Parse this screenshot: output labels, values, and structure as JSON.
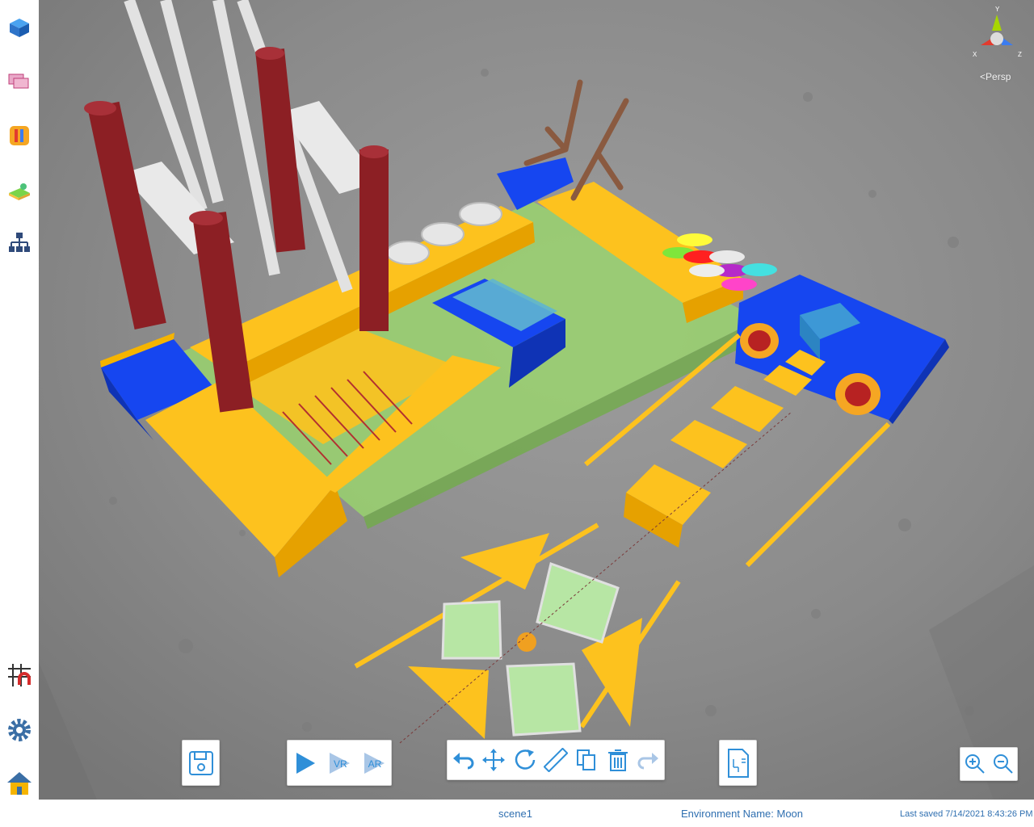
{
  "viewport": {
    "environment": "Moon",
    "view_mode": "Persp",
    "gizmo_axes": {
      "x": "X",
      "y": "Y",
      "z": "Z"
    }
  },
  "sidebar": {
    "items": [
      {
        "name": "objects",
        "icon": "cube-icon"
      },
      {
        "name": "materials",
        "icon": "layers-icon"
      },
      {
        "name": "tools",
        "icon": "pencils-icon"
      },
      {
        "name": "terrain",
        "icon": "landscape-icon"
      },
      {
        "name": "hierarchy",
        "icon": "hierarchy-icon"
      },
      {
        "name": "snap",
        "icon": "grid-magnet-icon"
      },
      {
        "name": "settings",
        "icon": "gear-icon"
      },
      {
        "name": "home",
        "icon": "home-icon"
      }
    ]
  },
  "toolbar": {
    "save": {
      "icon": "save-icon"
    },
    "play": {
      "play_icon": "play-icon",
      "vr_label": "VR",
      "ar_label": "AR"
    },
    "edit": [
      "undo-icon",
      "move-icon",
      "rotate-icon",
      "ruler-icon",
      "copy-icon",
      "trash-icon",
      "redo-icon"
    ],
    "script": {
      "icon": "script-icon"
    },
    "zoom": [
      "zoom-in-icon",
      "zoom-out-icon"
    ]
  },
  "status": {
    "scene_name": "scene1",
    "environment_label": "Environment Name: Moon",
    "last_saved": "Last saved 7/14/2021 8:43:26 PM"
  },
  "colors": {
    "yellow": "#fdc21e",
    "blue": "#1646f0",
    "green": "#9ad86a",
    "maroon": "#8c1f24",
    "ground": "#8b8b8b",
    "accent": "#2f8fd8"
  }
}
